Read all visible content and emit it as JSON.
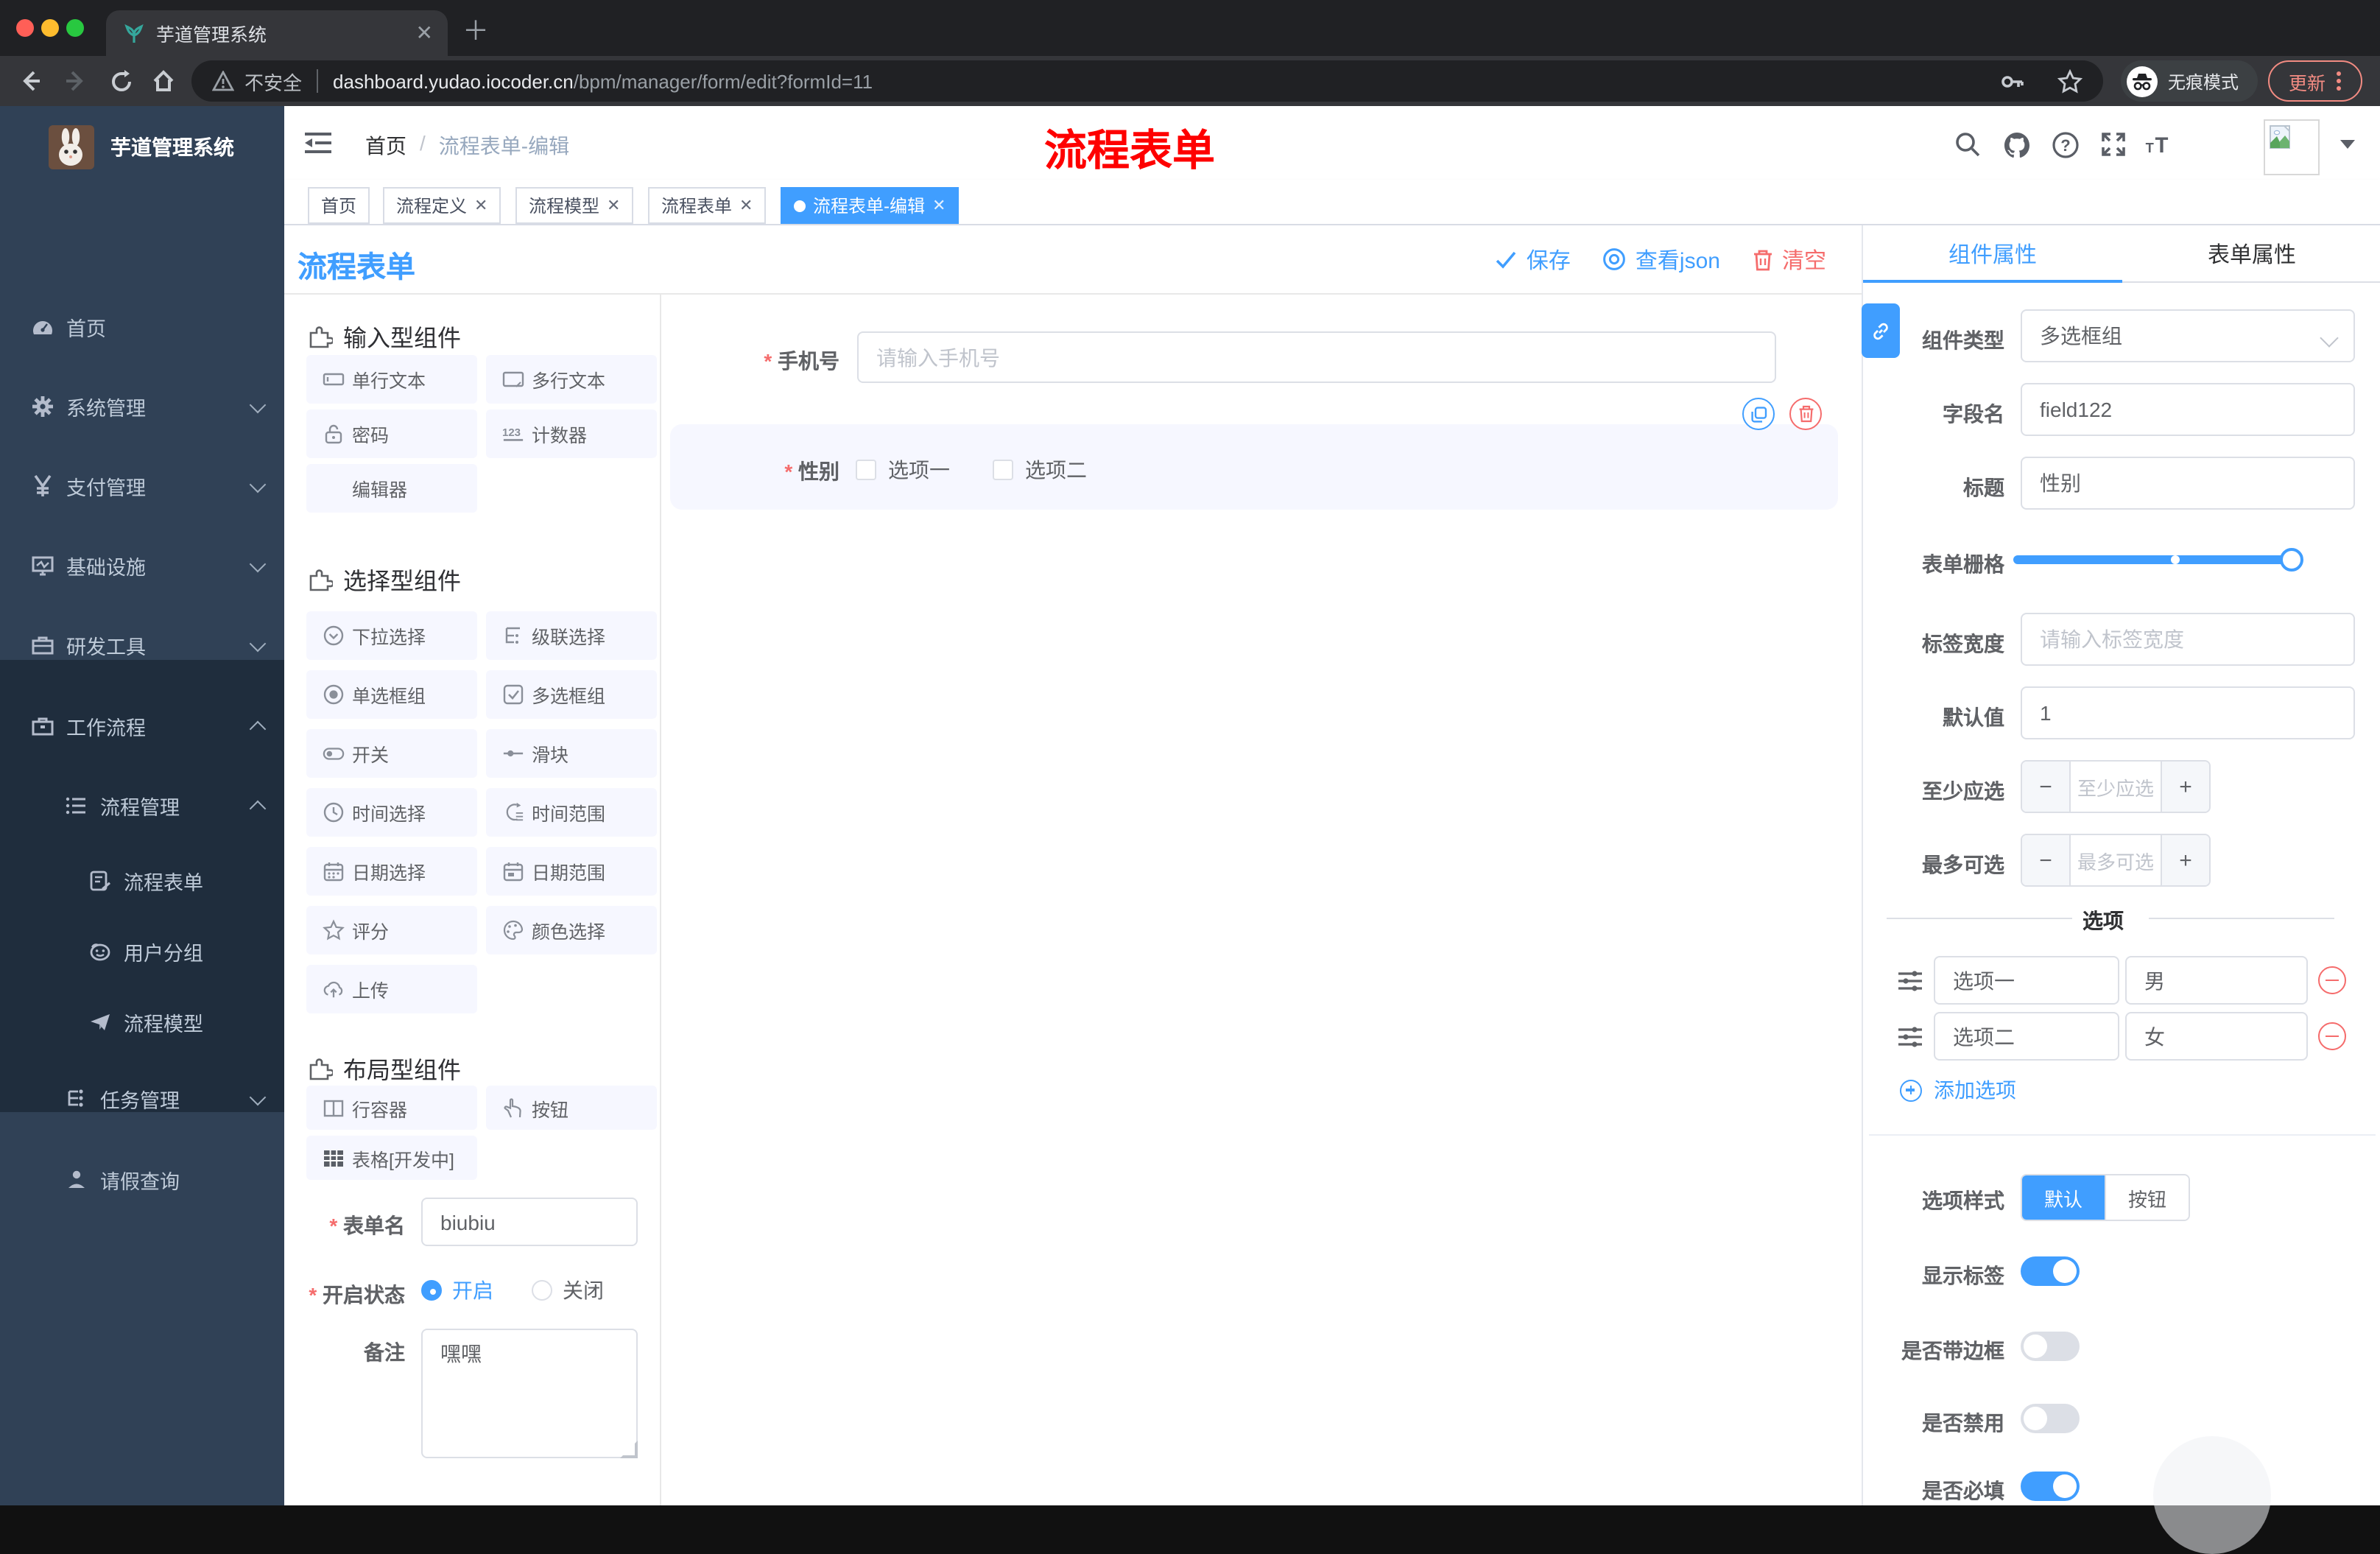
{
  "colors": {
    "accent": "#409eff",
    "danger": "#f56c6c",
    "sidebar": "#304156",
    "sidebar_submenu": "#1f2d3d",
    "red_title": "#fe0000"
  },
  "browser": {
    "tab_title": "芋道管理系统",
    "security_label": "不安全",
    "url_host": "dashboard.yudao.iocoder.cn",
    "url_path": "/bpm/manager/form/edit?formId=11",
    "incognito_label": "无痕模式",
    "update_label": "更新"
  },
  "sidebar": {
    "logo_title": "芋道管理系统",
    "items": [
      {
        "label": "首页"
      },
      {
        "label": "系统管理"
      },
      {
        "label": "支付管理"
      },
      {
        "label": "基础设施"
      },
      {
        "label": "研发工具"
      },
      {
        "label": "工作流程"
      },
      {
        "label": "流程管理"
      },
      {
        "label": "流程表单"
      },
      {
        "label": "用户分组"
      },
      {
        "label": "流程模型"
      },
      {
        "label": "任务管理"
      },
      {
        "label": "请假查询"
      }
    ]
  },
  "header": {
    "breadcrumb_home": "首页",
    "breadcrumb_current": "流程表单-编辑",
    "overlay_title": "流程表单"
  },
  "tags": [
    {
      "label": "首页",
      "active": false
    },
    {
      "label": "流程定义",
      "active": false
    },
    {
      "label": "流程模型",
      "active": false
    },
    {
      "label": "流程表单",
      "active": false
    },
    {
      "label": "流程表单-编辑",
      "active": true
    }
  ],
  "designer": {
    "title": "流程表单",
    "save_label": "保存",
    "view_json_label": "查看json",
    "clear_label": "清空"
  },
  "components_panel": {
    "sections": [
      {
        "title": "输入型组件",
        "items": [
          "单行文本",
          "多行文本",
          "密码",
          "计数器",
          "编辑器"
        ]
      },
      {
        "title": "选择型组件",
        "items": [
          "下拉选择",
          "级联选择",
          "单选框组",
          "多选框组",
          "开关",
          "滑块",
          "时间选择",
          "时间范围",
          "日期选择",
          "日期范围",
          "评分",
          "颜色选择",
          "上传"
        ]
      },
      {
        "title": "布局型组件",
        "items": [
          "行容器",
          "按钮",
          "表格[开发中]"
        ]
      }
    ],
    "form": {
      "name_label": "表单名",
      "name_value": "biubiu",
      "status_label": "开启状态",
      "status_on": "开启",
      "status_off": "关闭",
      "remark_label": "备注",
      "remark_value": "嘿嘿"
    }
  },
  "canvas": {
    "phone_label": "手机号",
    "phone_placeholder": "请输入手机号",
    "gender_label": "性别",
    "gender_option1": "选项一",
    "gender_option2": "选项二"
  },
  "props_panel": {
    "tab_component": "组件属性",
    "tab_form": "表单属性",
    "component_type_label": "组件类型",
    "component_type_value": "多选框组",
    "field_name_label": "字段名",
    "field_name_value": "field122",
    "title_label": "标题",
    "title_value": "性别",
    "grid_label": "表单栅格",
    "label_width_label": "标签宽度",
    "label_width_placeholder": "请输入标签宽度",
    "default_label": "默认值",
    "default_value": "1",
    "min_label": "至少应选",
    "min_placeholder": "至少应选",
    "max_label": "最多可选",
    "max_placeholder": "最多可选",
    "options_divider": "选项",
    "option_rows": [
      {
        "label": "选项一",
        "value": "男"
      },
      {
        "label": "选项二",
        "value": "女"
      }
    ],
    "add_option_label": "添加选项",
    "option_style_label": "选项样式",
    "style_default": "默认",
    "style_button": "按钮",
    "toggles": [
      {
        "label": "显示标签",
        "on": true
      },
      {
        "label": "是否带边框",
        "on": false
      },
      {
        "label": "是否禁用",
        "on": false
      },
      {
        "label": "是否必填",
        "on": true
      }
    ]
  }
}
